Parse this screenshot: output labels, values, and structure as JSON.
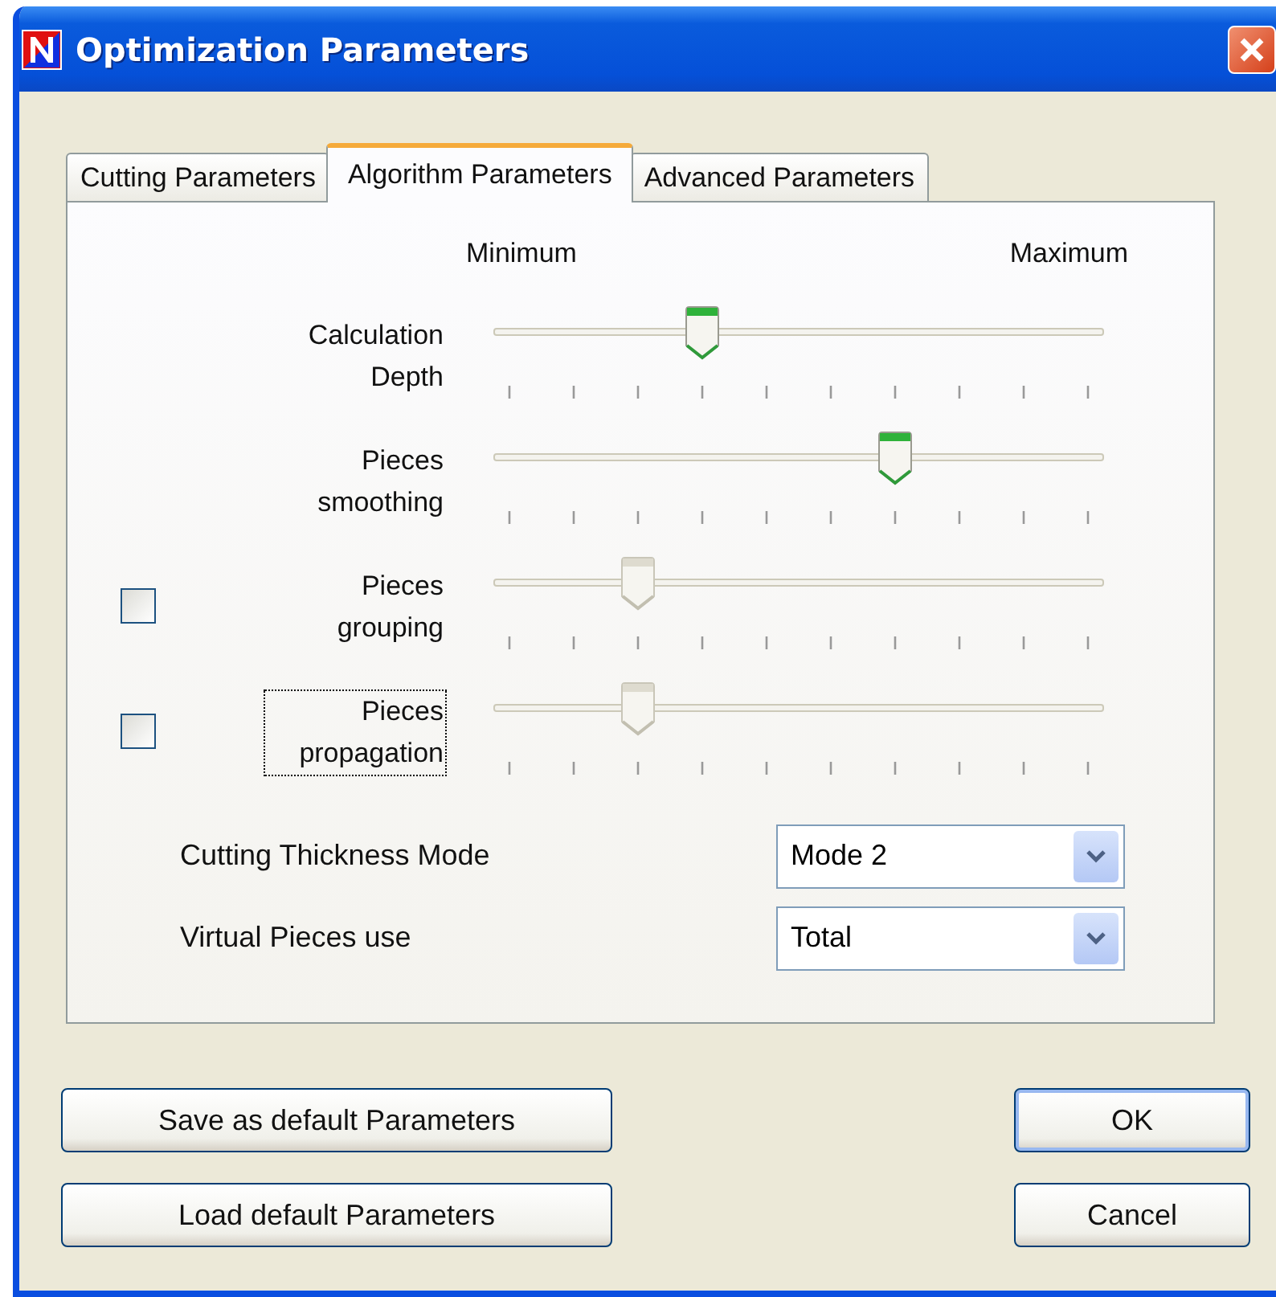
{
  "window": {
    "title": "Optimization Parameters"
  },
  "tabs": [
    {
      "label": "Cutting Parameters",
      "selected": false
    },
    {
      "label": "Algorithm Parameters",
      "selected": true
    },
    {
      "label": "Advanced Parameters",
      "selected": false
    }
  ],
  "scale": {
    "min_label": "Minimum",
    "max_label": "Maximum"
  },
  "sliders": [
    {
      "kind": "plain",
      "label": "Calculation Depth",
      "level": 0.333,
      "disabled": false,
      "focused": false
    },
    {
      "kind": "plain",
      "label": "Pieces smoothing",
      "level": 0.667,
      "disabled": false,
      "focused": false
    },
    {
      "kind": "checkable",
      "label": "Pieces grouping",
      "level": 0.222,
      "disabled": true,
      "checked": false,
      "focused": false
    },
    {
      "kind": "checkable",
      "label": "Pieces propagation",
      "level": 0.222,
      "disabled": true,
      "checked": false,
      "focused": true
    }
  ],
  "dropdowns": [
    {
      "label": "Cutting Thickness Mode",
      "value": "Mode 2"
    },
    {
      "label": "Virtual Pieces use",
      "value": "Total"
    }
  ],
  "left_buttons": [
    {
      "label": "Save as default Parameters",
      "default": false
    },
    {
      "label": "Load default Parameters",
      "default": false
    }
  ],
  "right_buttons": [
    {
      "label": "OK",
      "default": true
    },
    {
      "label": "Cancel",
      "default": false
    }
  ]
}
